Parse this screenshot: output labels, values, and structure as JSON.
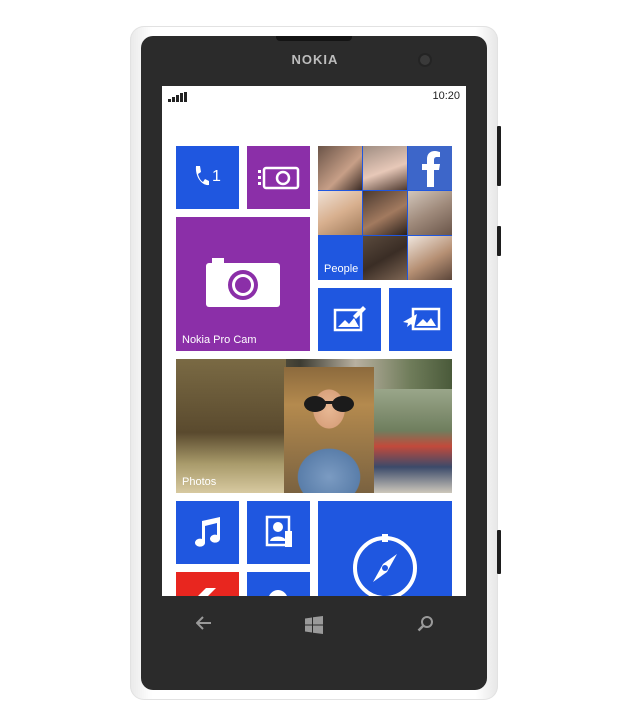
{
  "device": {
    "brand": "NOKIA"
  },
  "status_bar": {
    "signal_icon": "signal-bars-icon",
    "time": "10:20"
  },
  "tiles": {
    "phone": {
      "icon": "phone-icon",
      "badge": "1",
      "color": "#1f57e0"
    },
    "camera": {
      "icon": "camera-icon",
      "color": "#8b2fa8"
    },
    "people": {
      "label": "People",
      "color": "#1f57e0"
    },
    "nokia_pro_cam": {
      "label": "Nokia Pro Cam",
      "icon": "camera-ring-icon",
      "color": "#8b2fa8"
    },
    "photo_edit": {
      "icon": "photo-edit-icon",
      "color": "#1f57e0"
    },
    "photo_share": {
      "icon": "photo-share-icon",
      "color": "#1f57e0"
    },
    "photos": {
      "label": "Photos"
    },
    "music": {
      "icon": "music-note-icon",
      "color": "#1f57e0"
    },
    "contact_card": {
      "icon": "contact-card-icon",
      "color": "#1f57e0"
    },
    "compass": {
      "icon": "compass-icon",
      "color": "#1f57e0"
    },
    "red_tile": {
      "color": "#e8261f"
    },
    "blue_small": {
      "color": "#1f57e0"
    }
  },
  "nav": {
    "back_icon": "back-arrow-icon",
    "start_icon": "windows-logo-icon",
    "search_icon": "search-icon"
  }
}
